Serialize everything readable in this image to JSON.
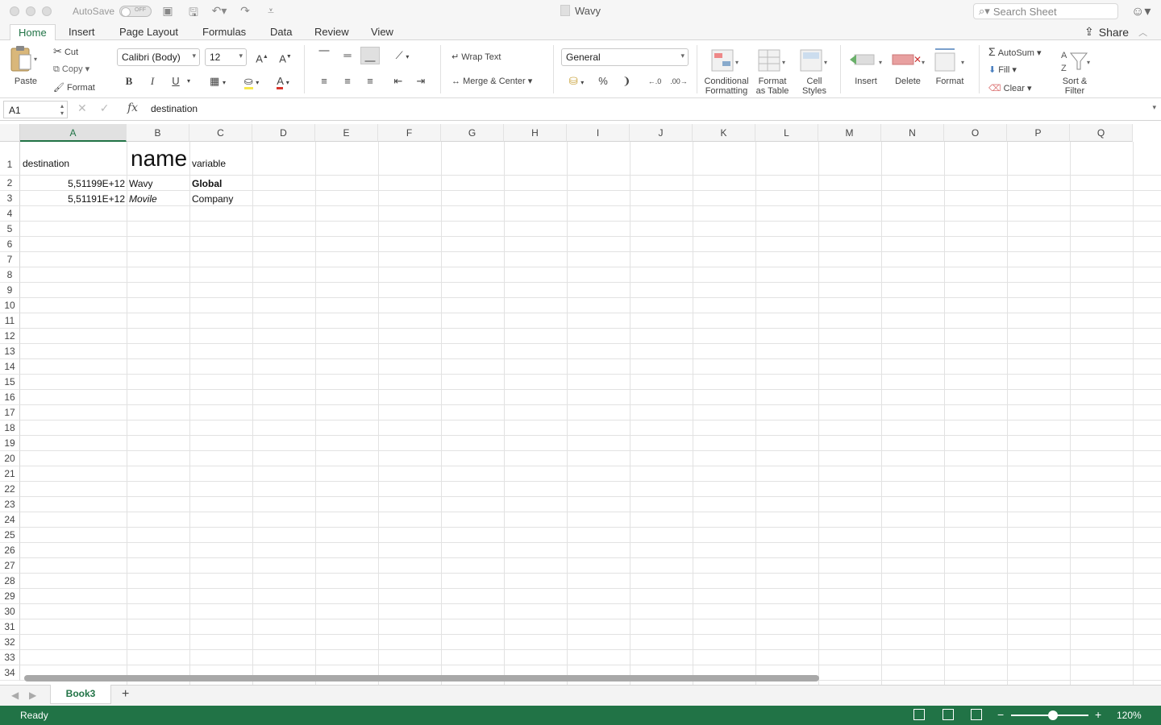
{
  "window": {
    "title": "Wavy",
    "autosave_label": "AutoSave",
    "autosave_state": "OFF",
    "search_placeholder": "Search Sheet"
  },
  "tabs": [
    "Home",
    "Insert",
    "Page Layout",
    "Formulas",
    "Data",
    "Review",
    "View"
  ],
  "active_tab": "Home",
  "share_label": "Share",
  "ribbon": {
    "paste": "Paste",
    "cut": "Cut",
    "copy": "Copy",
    "format_painter": "Format",
    "font_name": "Calibri (Body)",
    "font_size": "12",
    "bold": "B",
    "italic": "I",
    "underline": "U",
    "wrap_text": "Wrap Text",
    "merge_center": "Merge & Center",
    "number_format": "General",
    "percent": "%",
    "comma": "❩",
    "cond_format": [
      "Conditional",
      "Formatting"
    ],
    "format_table": [
      "Format",
      "as Table"
    ],
    "cell_styles": [
      "Cell",
      "Styles"
    ],
    "insert": "Insert",
    "delete": "Delete",
    "format": "Format",
    "autosum": "AutoSum",
    "fill": "Fill",
    "clear": "Clear",
    "sort_filter": [
      "Sort &",
      "Filter"
    ]
  },
  "formula_bar": {
    "name_box": "A1",
    "fx": "fx",
    "value": "destination"
  },
  "columns": [
    "A",
    "B",
    "C",
    "D",
    "E",
    "F",
    "G",
    "H",
    "I",
    "J",
    "K",
    "L",
    "M",
    "N",
    "O",
    "P",
    "Q"
  ],
  "selected_column": "A",
  "rows": [
    "1",
    "2",
    "3",
    "4",
    "5",
    "6",
    "7",
    "8",
    "9",
    "10",
    "11",
    "12",
    "13",
    "14",
    "15",
    "16",
    "17",
    "18",
    "19",
    "20",
    "21",
    "22",
    "23",
    "24",
    "25",
    "26",
    "27",
    "28",
    "29",
    "30",
    "31",
    "32",
    "33",
    "34"
  ],
  "cells": {
    "A1": "destination",
    "B1": "name",
    "C1": "variable",
    "A2": "5,51199E+12",
    "B2": "Wavy",
    "C2": "Global",
    "A3": "5,51191E+12",
    "B3": "Movile",
    "C3": "Company"
  },
  "sheet_tabs": [
    "Book3"
  ],
  "active_sheet": "Book3",
  "status": {
    "text": "Ready",
    "zoom": "120%"
  },
  "colors": {
    "accent": "#217346"
  }
}
